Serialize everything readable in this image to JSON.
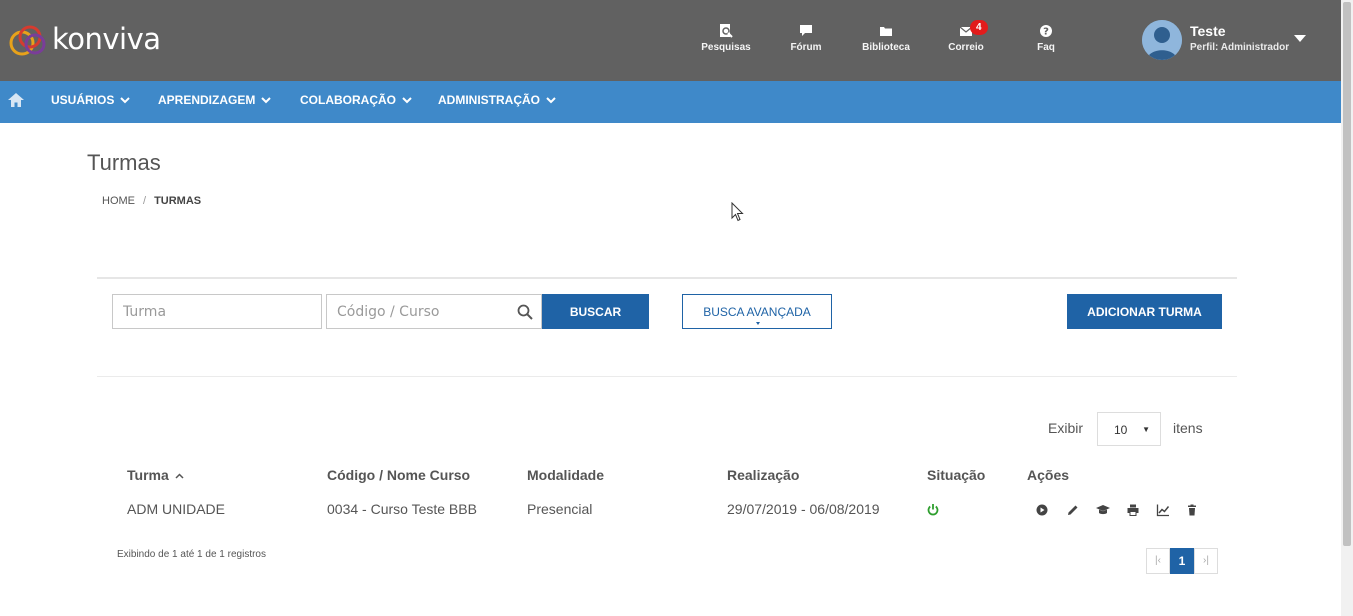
{
  "brand": {
    "name": "konviva"
  },
  "header": {
    "icons": [
      {
        "label": "Pesquisas",
        "icon": "survey-icon"
      },
      {
        "label": "Fórum",
        "icon": "chat-bubble-icon"
      },
      {
        "label": "Biblioteca",
        "icon": "folder-icon"
      },
      {
        "label": "Correio",
        "icon": "envelope-icon",
        "badge": "4"
      },
      {
        "label": "Faq",
        "icon": "question-icon"
      }
    ],
    "user": {
      "name": "Teste",
      "role": "Perfil: Administrador"
    }
  },
  "menu": {
    "items": [
      "USUÁRIOS",
      "APRENDIZAGEM",
      "COLABORAÇÃO",
      "ADMINISTRAÇÃO"
    ]
  },
  "page": {
    "title": "Turmas",
    "breadcrumb": {
      "home": "HOME",
      "sep": "/",
      "current": "TURMAS"
    }
  },
  "search": {
    "turma_placeholder": "Turma",
    "codigo_placeholder": "Código / Curso",
    "buscar_label": "BUSCAR",
    "avancada_label": "BUSCA AVANÇADA",
    "add_label": "ADICIONAR TURMA"
  },
  "table": {
    "show_label": "Exibir",
    "page_size": "10",
    "items_label": "itens",
    "columns": [
      "Turma",
      "Código / Nome Curso",
      "Modalidade",
      "Realização",
      "Situação",
      "Ações"
    ],
    "rows": [
      {
        "turma": "ADM UNIDADE",
        "curso": "0034 - Curso Teste BBB",
        "modalidade": "Presencial",
        "realizacao": "29/07/2019 - 06/08/2019",
        "situacao": "active"
      }
    ],
    "footer": "Exibindo de 1 até 1 de 1 registros",
    "pagination": {
      "first": "|‹",
      "current": "1",
      "last": "›|"
    }
  },
  "colors": {
    "header_bg": "#616161",
    "menu_bg": "#3f89c9",
    "primary": "#1f63a6",
    "badge": "#e21b1b",
    "active_status": "#2e9e2e"
  }
}
